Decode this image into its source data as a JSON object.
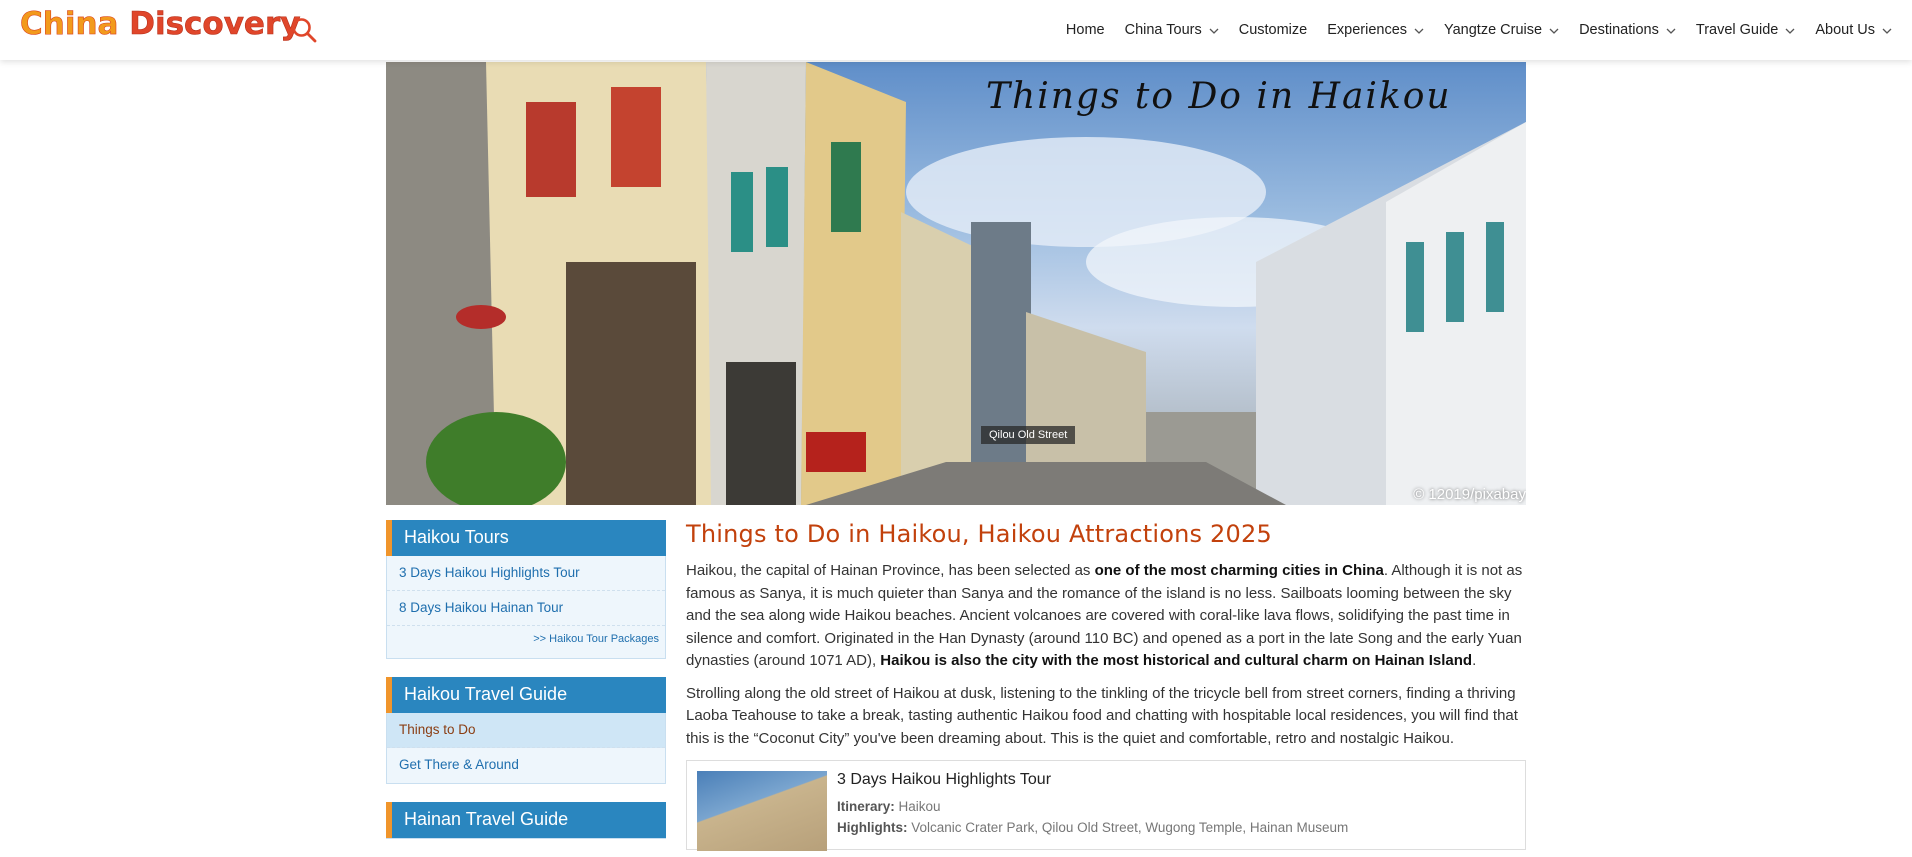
{
  "header": {
    "logo": "China Discovery",
    "logo_first": "China",
    "logo_second": "Discovery",
    "nav": [
      {
        "label": "Home",
        "dropdown": false
      },
      {
        "label": "China Tours",
        "dropdown": true
      },
      {
        "label": "Customize",
        "dropdown": false
      },
      {
        "label": "Experiences",
        "dropdown": true
      },
      {
        "label": "Yangtze Cruise",
        "dropdown": true
      },
      {
        "label": "Destinations",
        "dropdown": true
      },
      {
        "label": "Travel Guide",
        "dropdown": true
      },
      {
        "label": "About Us",
        "dropdown": true
      }
    ]
  },
  "hero": {
    "title": "Things to Do in Haikou",
    "caption": "Qilou Old Street",
    "credit": "© 12019/pixabay"
  },
  "sidebar": {
    "tours": {
      "title": "Haikou Tours",
      "links": [
        "3 Days Haikou Highlights Tour",
        "8 Days Haikou Hainan Tour"
      ],
      "more": ">> Haikou Tour Packages"
    },
    "guide": {
      "title": "Haikou Travel Guide",
      "links": [
        "Things to Do",
        "Get There & Around"
      ]
    },
    "hainan": {
      "title": "Hainan Travel Guide"
    }
  },
  "main": {
    "heading": "Things to Do in Haikou, Haikou Attractions 2025",
    "p1_a": "Haikou, the capital of Hainan Province, has been selected as ",
    "p1_b": "one of the most charming cities in China",
    "p1_c": ". Although it is not as famous as Sanya, it is much quieter than Sanya and the romance of the island is no less. Sailboats looming between the sky and the sea along wide Haikou beaches. Ancient volcanoes are covered with coral-like lava flows, solidifying the past time in silence and comfort. Originated in the Han Dynasty (around 110 BC) and opened as a port in the late Song and the early Yuan dynasties (around 1071 AD), ",
    "p1_d": "Haikou is also the city with the most historical and cultural charm on Hainan Island",
    "p1_e": ".",
    "p2": "Strolling along the old street of Haikou at dusk, listening to the tinkling of the tricycle bell from street corners, finding a thriving Laoba Teahouse to take a break, tasting authentic Haikou food and chatting with hospitable local residences, you will find that this is the “Coconut City” you've been dreaming about. This is the quiet and comfortable, retro and nostalgic Haikou.",
    "tour_card": {
      "name": "3 Days Haikou Highlights Tour",
      "itinerary_label": "Itinerary:",
      "itinerary": "Haikou",
      "highlights_label": "Highlights:",
      "highlights": "Volcanic Crater Park, Qilou Old Street, Wugong Temple, Hainan Museum"
    }
  },
  "colors": {
    "accent_orange": "#c2410c",
    "sidebar_title_bg": "#2a86bf",
    "sidebar_title_border": "#f0952b",
    "link_blue": "#1f6fae"
  }
}
